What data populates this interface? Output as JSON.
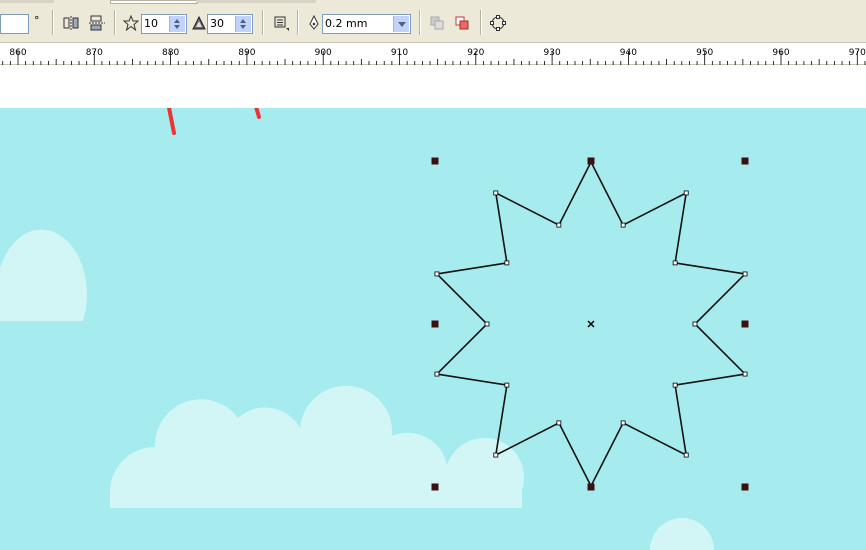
{
  "toolbar": {
    "angle_value": "",
    "degree_symbol": "°",
    "points_value": "10",
    "sharpness_value": "30",
    "outline_width": "0.2 mm"
  },
  "ruler": {
    "labels": [
      "860",
      "870",
      "880",
      "890",
      "900",
      "910",
      "920",
      "930",
      "940",
      "950",
      "960",
      "970"
    ]
  },
  "colors": {
    "canvas_bg": "#a6ecef",
    "cloud": "#d2f5f6",
    "arrow": "#ee3333",
    "handle": "#3d1010"
  },
  "star": {
    "points": 10,
    "sharpness": 30
  }
}
